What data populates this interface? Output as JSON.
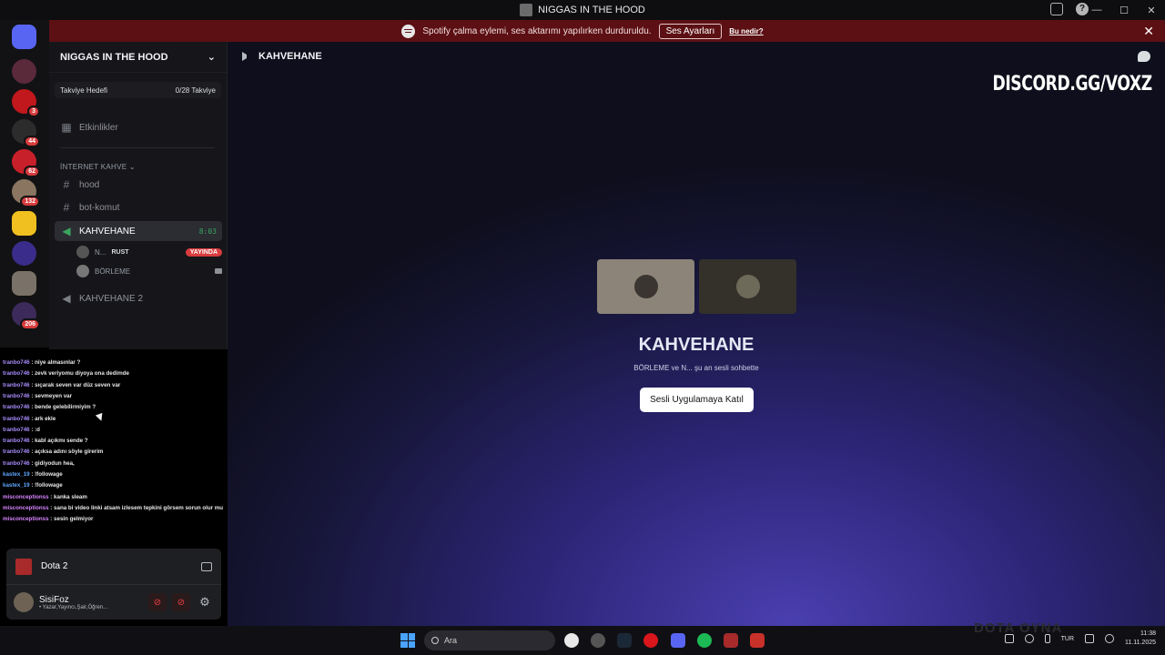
{
  "window": {
    "title": "NIGGAS IN THE HOOD"
  },
  "banner": {
    "message": "Spotify çalma eylemi, ses aktarımı yapılırken durduruldu.",
    "button_label": "Ses Ayarları",
    "link_label": "Bu nedir?"
  },
  "rail": {
    "badges": [
      "3",
      "44",
      "62",
      "132",
      "206"
    ]
  },
  "server": {
    "name": "NIGGAS IN THE HOOD",
    "boost_label": "Takviye Hedefi",
    "boost_value": "0/28 Takviye",
    "events_label": "Etkinlikler",
    "category": "İNTERNET KAHVE",
    "channels": {
      "hood": "hood",
      "bot": "bot-komut",
      "kahvehane": "KAHVEHANE",
      "kahvehane_timer": "8:03",
      "kahvehane2": "KAHVEHANE 2"
    },
    "voice_users": [
      {
        "name": "N...",
        "game": "RUST",
        "status": "YAYINDA"
      },
      {
        "name": "BÖRLEME"
      }
    ]
  },
  "chat": [
    {
      "user": "tranbo746",
      "text": ": niye almasınlar ?"
    },
    {
      "user": "tranbo746",
      "text": ": zevk veriyomu diyoya ona dedimde"
    },
    {
      "user": "tranbo746",
      "text": ": sıçarak seven var düz seven var"
    },
    {
      "user": "tranbo746",
      "text": ": sevmeyen var"
    },
    {
      "user": "tranbo746",
      "text": ": bende gelebilirmiyim ?"
    },
    {
      "user": "tranbo746",
      "text": ": ark ekle"
    },
    {
      "user": "tranbo746",
      "text": ": :d"
    },
    {
      "user": "tranbo746",
      "text": ": kabl açıkmı sende ?"
    },
    {
      "user": "tranbo746",
      "text": ": açıksa adını söyle girerim"
    },
    {
      "user": "tranbo746",
      "text": ": gidiyodun hea,"
    },
    {
      "user": "kastex_19",
      "text": ": !followage"
    },
    {
      "user": "kastex_19",
      "text": ": !followage"
    },
    {
      "user": "misconceptionss",
      "text": ": kanka sleam"
    },
    {
      "user": "misconceptionss",
      "text": ": sana bi video linki atsam izlesem tepkini görsem sorun olur mu"
    },
    {
      "user": "misconceptionss",
      "text": ": sesin gelmiyor"
    }
  ],
  "user_panel": {
    "game": "Dota 2",
    "username": "SisiFoz",
    "status": "• Yazar,Yayıncı,Şair,Öğren..."
  },
  "main": {
    "channel_name": "KAHVEHANE",
    "watermark": "DISCORD.GG/VOXZ",
    "voice_title": "KAHVEHANE",
    "voice_subtitle": "BÖRLEME ve N... şu an sesli sohbette",
    "join_button": "Sesli Uygulamaya Katıl"
  },
  "taskbar": {
    "search_placeholder": "Ara",
    "ghost_text": "DOTA OYNA",
    "language": "TUR",
    "time": "11:38",
    "date": "11.11.2025"
  }
}
